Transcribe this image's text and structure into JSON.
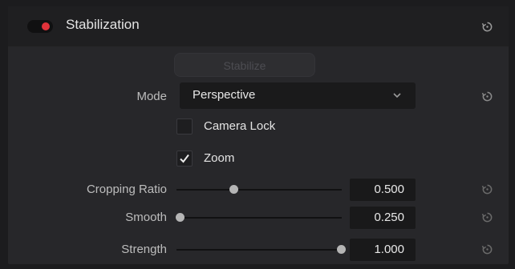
{
  "header": {
    "title": "Stabilization",
    "enabled": true,
    "accent": "#e0323a"
  },
  "stabilize_button": {
    "label": "Stabilize",
    "enabled": false
  },
  "mode": {
    "label": "Mode",
    "value": "Perspective"
  },
  "options": [
    {
      "label": "Camera Lock",
      "checked": false
    },
    {
      "label": "Zoom",
      "checked": true
    }
  ],
  "sliders": [
    {
      "label": "Cropping Ratio",
      "value": "0.500",
      "fraction": 0.5
    },
    {
      "label": "Smooth",
      "value": "0.250",
      "fraction": 0.0
    },
    {
      "label": "Strength",
      "value": "1.000",
      "fraction": 1.0
    }
  ],
  "icons": {
    "reset": "reset-icon",
    "chevron": "chevron-down-icon",
    "check": "checkmark-icon"
  }
}
